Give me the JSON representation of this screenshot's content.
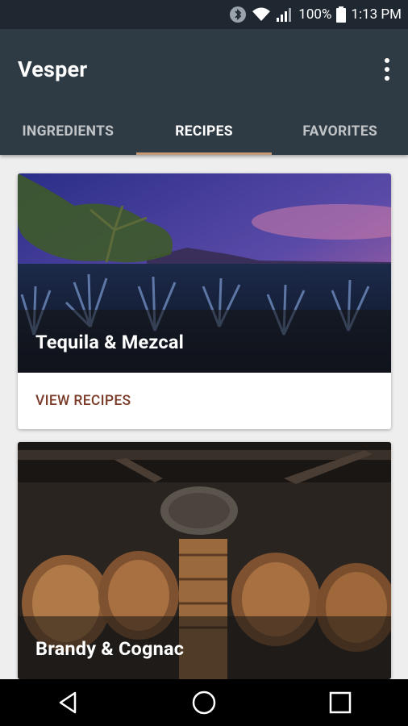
{
  "status": {
    "battery": "100%",
    "time": "1:13 PM"
  },
  "app": {
    "title": "Vesper"
  },
  "tabs": [
    {
      "label": "INGREDIENTS"
    },
    {
      "label": "RECIPES"
    },
    {
      "label": "FAVORITES"
    }
  ],
  "cards": [
    {
      "title": "Tequila & Mezcal",
      "action": "VIEW RECIPES"
    },
    {
      "title": "Brandy & Cognac"
    }
  ],
  "colors": {
    "appbar": "#2f3b44",
    "statusbar": "#1f2830",
    "tab_indicator": "#c49a76",
    "action_text": "#7a3b28"
  }
}
